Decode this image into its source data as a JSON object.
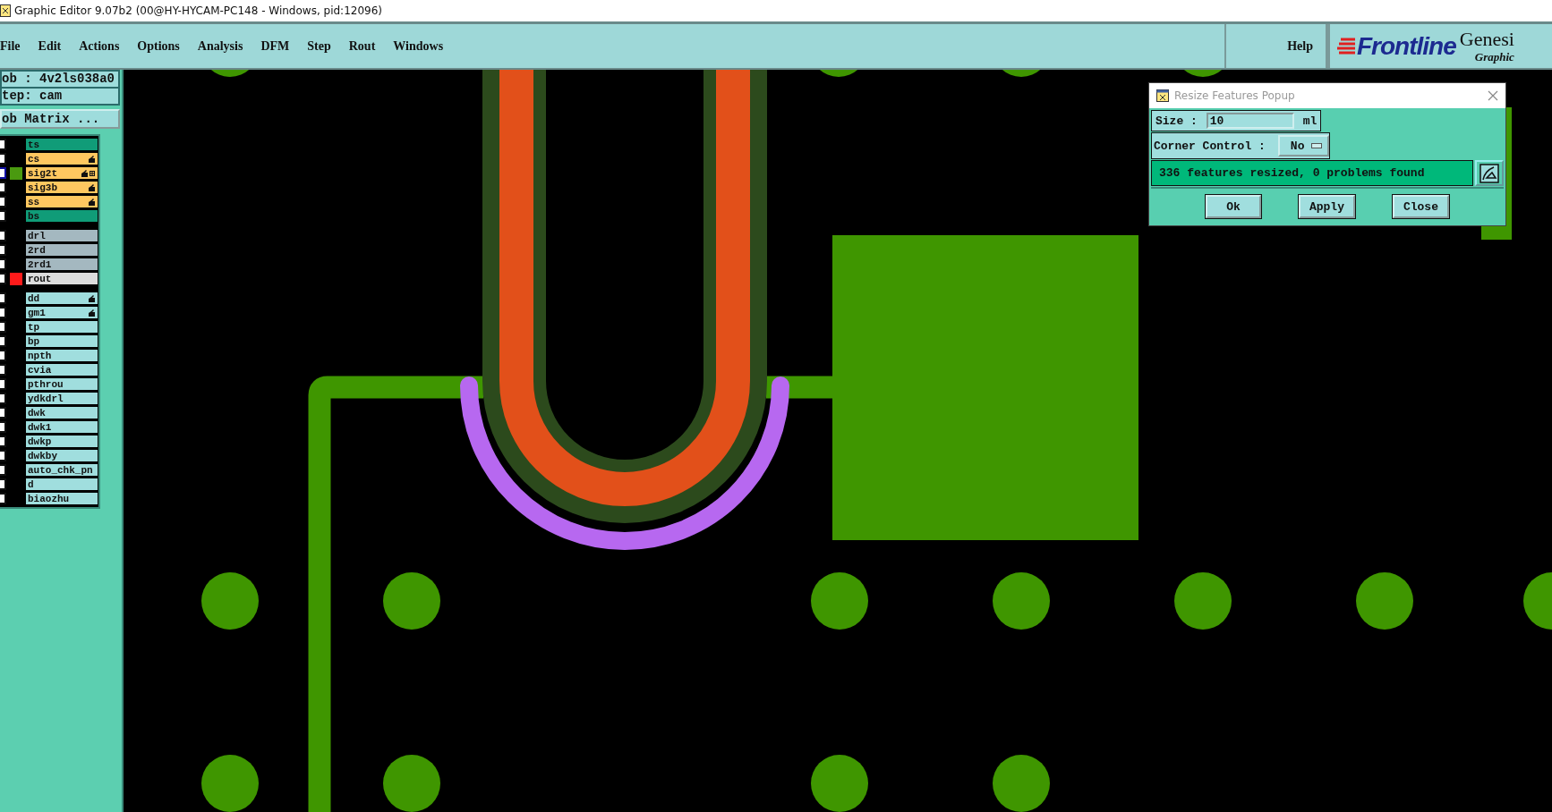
{
  "window": {
    "title": "Graphic Editor 9.07b2 (00@HY-HYCAM-PC148 - Windows, pid:12096)"
  },
  "menu": [
    "File",
    "Edit",
    "Actions",
    "Options",
    "Analysis",
    "DFM",
    "Step",
    "Rout",
    "Windows"
  ],
  "help": "Help",
  "logo": {
    "brand": "Frontline",
    "product": "Genesi",
    "subtitle": "Graphic"
  },
  "job": {
    "job_label": "ob : 4v2ls038a0",
    "step_label": "tep: cam",
    "matrix_button": "ob Matrix ..."
  },
  "layer_groups": [
    {
      "layers": [
        {
          "name": "ts",
          "kind": "mask",
          "affected": false,
          "selected": false
        },
        {
          "name": "cs",
          "kind": "signal",
          "affected": true,
          "selected": false
        },
        {
          "name": "sig2t",
          "kind": "signal",
          "affected": true,
          "selected": true,
          "color": "#4a9a10"
        },
        {
          "name": "sig3b",
          "kind": "signal",
          "affected": true,
          "selected": false
        },
        {
          "name": "ss",
          "kind": "signal",
          "affected": true,
          "selected": false
        },
        {
          "name": "bs",
          "kind": "mask",
          "affected": false,
          "selected": false
        }
      ]
    },
    {
      "layers": [
        {
          "name": "drl",
          "kind": "drill",
          "affected": false,
          "selected": false
        },
        {
          "name": "2rd",
          "kind": "drill",
          "affected": false,
          "selected": false
        },
        {
          "name": "2rd1",
          "kind": "drill",
          "affected": false,
          "selected": false
        },
        {
          "name": "rout",
          "kind": "rout",
          "affected": false,
          "selected": false,
          "color": "#ff1a1a"
        }
      ]
    },
    {
      "layers": [
        {
          "name": "dd",
          "kind": "document",
          "affected": true,
          "selected": false
        },
        {
          "name": "gm1",
          "kind": "document",
          "affected": true,
          "selected": false
        },
        {
          "name": "tp",
          "kind": "document",
          "affected": false,
          "selected": false
        },
        {
          "name": "bp",
          "kind": "document",
          "affected": false,
          "selected": false
        },
        {
          "name": "npth",
          "kind": "document",
          "affected": false,
          "selected": false
        },
        {
          "name": "cvia",
          "kind": "document",
          "affected": false,
          "selected": false
        },
        {
          "name": "pthrou",
          "kind": "document",
          "affected": false,
          "selected": false
        },
        {
          "name": "ydkdrl",
          "kind": "document",
          "affected": false,
          "selected": false
        },
        {
          "name": "dwk",
          "kind": "document",
          "affected": false,
          "selected": false
        },
        {
          "name": "dwk1",
          "kind": "document",
          "affected": false,
          "selected": false
        },
        {
          "name": "dwkp",
          "kind": "document",
          "affected": false,
          "selected": false
        },
        {
          "name": "dwkby",
          "kind": "document",
          "affected": false,
          "selected": false
        },
        {
          "name": "auto_chk_pn",
          "kind": "document",
          "affected": false,
          "selected": false
        },
        {
          "name": "d",
          "kind": "document",
          "affected": false,
          "selected": false
        },
        {
          "name": "biaozhu",
          "kind": "document",
          "affected": false,
          "selected": false
        }
      ]
    }
  ],
  "popup": {
    "title": "Resize Features Popup",
    "size_label": "Size :",
    "size_value": "10",
    "size_unit": "ml",
    "corner_label": "Corner Control :",
    "corner_value": "No",
    "status": "336 features resized, 0 problems found",
    "buttons": [
      "Ok",
      "Apply",
      "Close"
    ]
  }
}
